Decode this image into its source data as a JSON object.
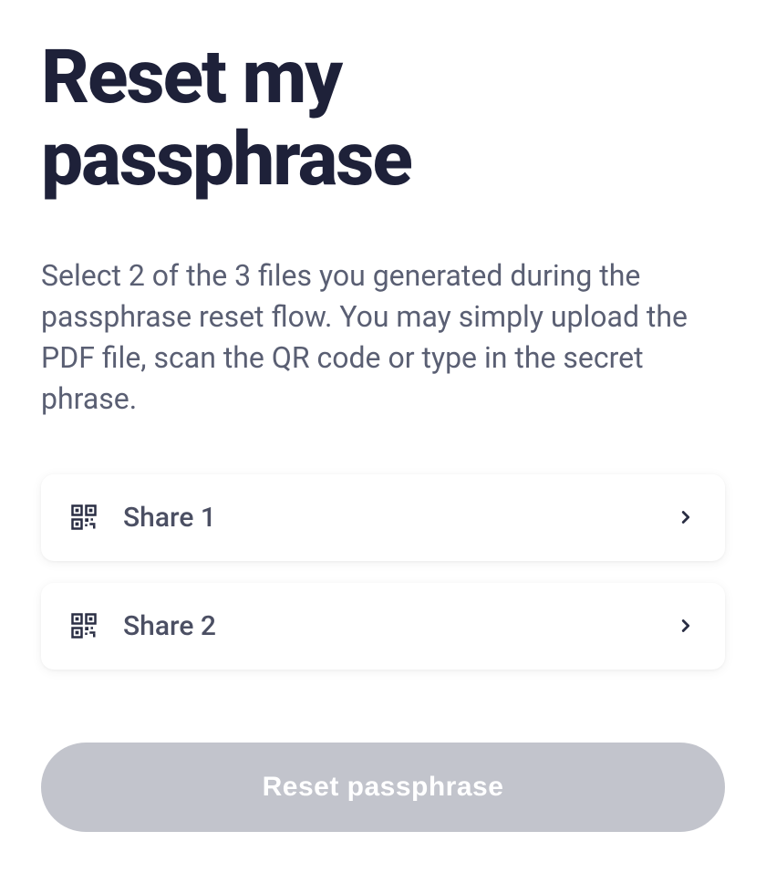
{
  "header": {
    "title": "Reset my passphrase"
  },
  "description": "Select 2 of the 3 files you generated during the passphrase reset flow. You may simply upload the PDF file, scan the QR code or type in the secret phrase.",
  "shares": [
    {
      "label": "Share 1"
    },
    {
      "label": "Share 2"
    }
  ],
  "actions": {
    "reset_label": "Reset passphrase"
  }
}
